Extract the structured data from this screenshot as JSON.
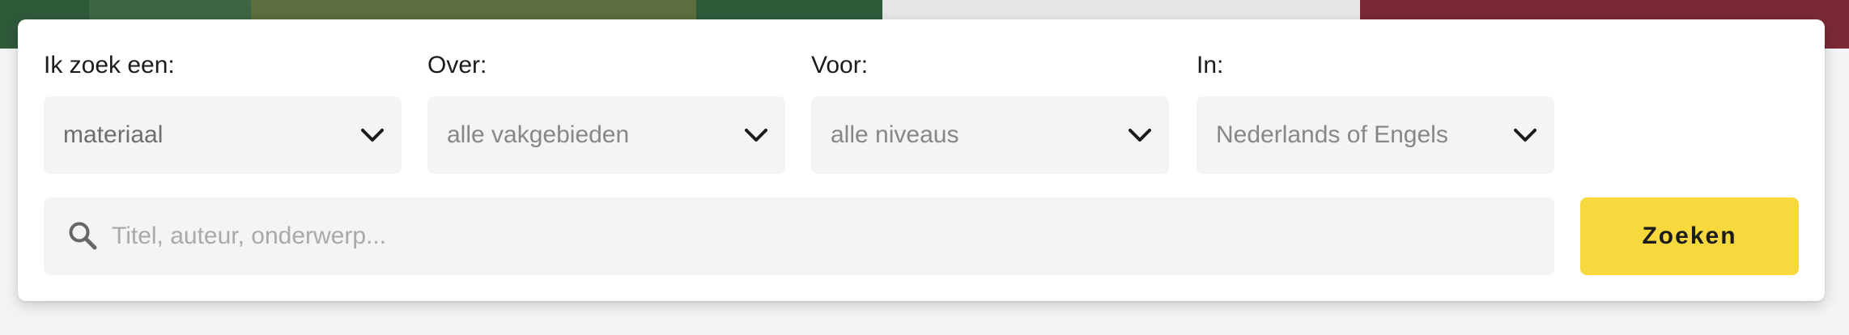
{
  "search": {
    "filters": [
      {
        "label": "Ik zoek een:",
        "value": "materiaal"
      },
      {
        "label": "Over:",
        "value": "alle vakgebieden"
      },
      {
        "label": "Voor:",
        "value": "alle niveaus"
      },
      {
        "label": "In:",
        "value": "Nederlands of Engels"
      }
    ],
    "input": {
      "placeholder": "Titel, auteur, onderwerp...",
      "value": ""
    },
    "button_label": "Zoeken",
    "search_icon": "search-icon",
    "chevron_icon": "chevron-down-icon"
  },
  "colors": {
    "accent": "#f7d83d",
    "field_bg": "#f3f4f6",
    "card_bg": "#ffffff",
    "page_bg": "#f3f4f5"
  }
}
